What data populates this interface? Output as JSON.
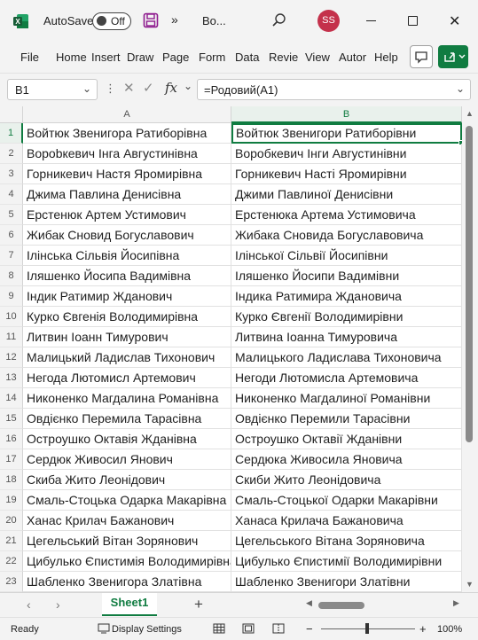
{
  "titlebar": {
    "autosave_label": "AutoSave",
    "autosave_state": "Off",
    "more_glyph": "»",
    "doc_title": "Bo...",
    "user_initials": "SS"
  },
  "ribbon": {
    "tabs": [
      "File",
      "Home",
      "Insert",
      "Draw",
      "Page",
      "Form",
      "Data",
      "Revie",
      "View",
      "Autor",
      "Help"
    ]
  },
  "formula_bar": {
    "name_box": "B1",
    "fx": "fx",
    "formula": "=Родовий(A1)"
  },
  "grid": {
    "columns": [
      "A",
      "B"
    ],
    "selected_column": "B",
    "selected_row": 1,
    "rows": [
      {
        "n": "1",
        "a": "Войтюк Звенигора Ратиборівна",
        "b": "Войтюк Звенигори Ратиборівни"
      },
      {
        "n": "2",
        "a": "Ворobкевич Інга Августинівна",
        "b": "Воробкевич Інги Августинівни"
      },
      {
        "n": "3",
        "a": "Горникевич Настя Яромирівна",
        "b": "Горникевич Насті Яромирівни"
      },
      {
        "n": "4",
        "a": "Джима Павлина Денисівна",
        "b": "Джими Павлиної Денисівни"
      },
      {
        "n": "5",
        "a": "Ерстенюк Артем Устимович",
        "b": "Ерстенюка Артема Устимовича"
      },
      {
        "n": "6",
        "a": "Жибак Сновид Богуславович",
        "b": "Жибака Сновида Богуславовича"
      },
      {
        "n": "7",
        "a": "Ілінська Сільвія Йосипівна",
        "b": "Ілінської Сільвії Йосипівни"
      },
      {
        "n": "8",
        "a": "Іляшенко Йосипа Вадимівна",
        "b": "Іляшенко Йосипи Вадимівни"
      },
      {
        "n": "9",
        "a": "Індик Ратимир Жданович",
        "b": "Індика Ратимира Ждановича"
      },
      {
        "n": "10",
        "a": "Курко Євгенія Володимирівна",
        "b": "Курко Євгенії Володимирівни"
      },
      {
        "n": "11",
        "a": "Литвин Іоанн Тимурович",
        "b": "Литвина Іоанна Тимуровича"
      },
      {
        "n": "12",
        "a": "Малицький Ладислав Тихонович",
        "b": "Малицького Ладислава Тихоновича"
      },
      {
        "n": "13",
        "a": "Негода Лютомисл Артемович",
        "b": "Негоди Лютомисла Артемовича"
      },
      {
        "n": "14",
        "a": "Никоненко Магдалина Романівна",
        "b": "Никоненко Магдалиної Романівни"
      },
      {
        "n": "15",
        "a": "Овдієнко Перемила Тарасівна",
        "b": "Овдієнко Перемили Тарасівни"
      },
      {
        "n": "16",
        "a": "Остроушко Октавія Жданівна",
        "b": "Остроушко Октавії Жданівни"
      },
      {
        "n": "17",
        "a": "Сердюк Живосил Янович",
        "b": "Сердюка Живосила Яновича"
      },
      {
        "n": "18",
        "a": "Скиба Жито Леонідович",
        "b": "Скиби Жито Леонідовича"
      },
      {
        "n": "19",
        "a": "Смаль-Стоцька Одарка Макарівна",
        "b": "Смаль-Стоцької Одарки Макарівни"
      },
      {
        "n": "20",
        "a": "Ханас Крилач Бажанович",
        "b": "Ханаса Крилача Бажановича"
      },
      {
        "n": "21",
        "a": "Цегельський Вітан Зорянович",
        "b": "Цегельського Вітана Зоряновича"
      },
      {
        "n": "22",
        "a": "Цибулько Єпистимія Володимирівна",
        "b": "Цибулько Єпистимії Володимирівни"
      },
      {
        "n": "23",
        "a": "Шабленко Звенигора Златівна",
        "b": "Шабленко Звенигори Златівни"
      }
    ]
  },
  "sheets": {
    "active": "Sheet1",
    "add_glyph": "+"
  },
  "status": {
    "ready": "Ready",
    "display_settings": "Display Settings",
    "zoom_minus": "−",
    "zoom_plus": "+",
    "zoom": "100%"
  },
  "colors": {
    "accent": "#107c41",
    "avatar": "#c4314b",
    "save_icon": "#8e1a8e"
  }
}
